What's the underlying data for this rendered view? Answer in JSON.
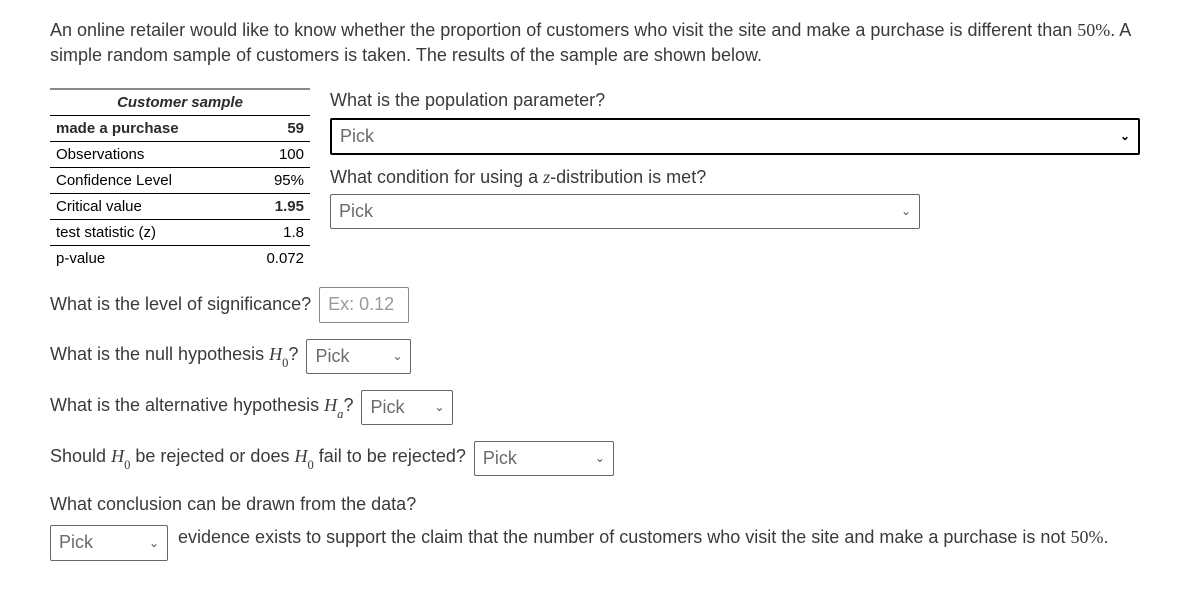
{
  "intro": {
    "part1": "An online retailer would like to know whether the proportion of customers who visit the site and make a purchase is different than ",
    "percent1": "50%",
    "part2": ". A simple random sample of customers is taken. The results of the sample are shown below."
  },
  "table": {
    "header": "Customer sample",
    "rows": [
      {
        "label": "made a purchase",
        "value": "59",
        "bold": true
      },
      {
        "label": "Observations",
        "value": "100",
        "bold": false
      },
      {
        "label": "Confidence Level",
        "value": "95%",
        "bold": false
      },
      {
        "label": "Critical value",
        "value": "1.95",
        "bold": false
      },
      {
        "label": "test statistic (z)",
        "value": "1.8",
        "bold": false
      },
      {
        "label": "p-value",
        "value": "0.072",
        "bold": false
      }
    ]
  },
  "questions": {
    "pop_param": "What is the population parameter?",
    "pick": "Pick",
    "z_cond_a": "What condition for using a ",
    "z_letter": "z",
    "z_cond_b": "-distribution is met?",
    "sig_level": "What is the level of significance?",
    "sig_placeholder": "Ex: 0.12",
    "null_a": "What is the null hypothesis ",
    "H0": "H",
    "sub0": "0",
    "qmark": "?",
    "alt_a": "What is the alternative hypothesis ",
    "Ha": "H",
    "suba": "a",
    "reject_a": "Should ",
    "reject_b": " be rejected or does ",
    "reject_c": " fail to be rejected?",
    "conclusion_q": "What conclusion can be drawn from the data?",
    "conclusion_text_a": "evidence exists to support the claim that the number of customers who visit the site and make a purchase is not ",
    "percent2": "50%",
    "conclusion_text_b": "."
  }
}
